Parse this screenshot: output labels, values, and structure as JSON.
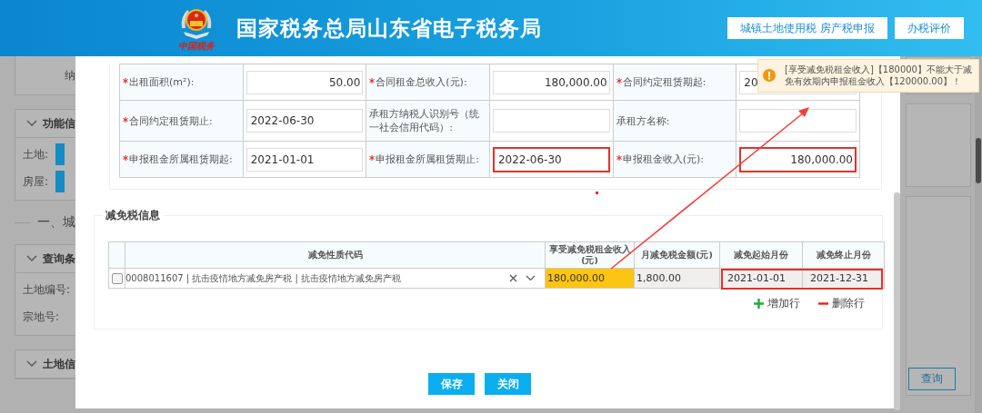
{
  "header": {
    "logo_caption": "中国税务",
    "title": "国家税务总局山东省电子税务局",
    "nav_buttons": [
      "城镇土地使用税 房产税申报",
      "办税评价"
    ]
  },
  "background_page": {
    "left": {
      "top_label": "纳",
      "panels": [
        {
          "title": "功能信",
          "fields": [
            "土地:",
            "房屋:"
          ]
        },
        {
          "section": "一、城"
        },
        {
          "title": "查询条",
          "fields": [
            "土地编号:",
            "宗地号:"
          ]
        },
        {
          "title": "土地信"
        }
      ]
    },
    "query_button": "查询"
  },
  "form": {
    "rows": [
      [
        {
          "kind": "label",
          "text": "出租面积(m²):",
          "required": true
        },
        {
          "kind": "amount",
          "value": "50.00",
          "highlighted": false
        },
        {
          "kind": "label",
          "text": "合同租金总收入(元):",
          "required": true
        },
        {
          "kind": "amount",
          "value": "180,000.00",
          "highlighted": false
        },
        {
          "kind": "label",
          "text": "合同约定租赁期起:",
          "required": true
        },
        {
          "kind": "input",
          "value": "20",
          "highlighted": false
        }
      ],
      [
        {
          "kind": "label",
          "text": "合同约定租赁期止:",
          "required": true
        },
        {
          "kind": "input",
          "value": "2022-06-30",
          "highlighted": false
        },
        {
          "kind": "label",
          "text": "承租方纳税人识别号（统一社会信用代码）:",
          "required": false
        },
        {
          "kind": "input",
          "highlighted": false
        },
        {
          "kind": "label",
          "text": "承租方名称:",
          "required": false
        },
        {
          "kind": "input",
          "highlighted": false
        }
      ],
      [
        {
          "kind": "label",
          "text": "申报租金所属租赁期起:",
          "required": true
        },
        {
          "kind": "input",
          "value": "2021-01-01",
          "highlighted": false
        },
        {
          "kind": "label",
          "text": "申报租金所属租赁期止:",
          "required": true
        },
        {
          "kind": "input",
          "value": "2022-06-30",
          "highlighted": true
        },
        {
          "kind": "label",
          "text": "申报租金收入(元):",
          "required": true
        },
        {
          "kind": "amount",
          "value": "180,000.00",
          "highlighted": true
        }
      ]
    ]
  },
  "reduction": {
    "title": "减免税信息",
    "columns": [
      "减免性质代码",
      "享受减免税租金收入(元)",
      "月减免税金额(元)",
      "减免起始月份",
      "减免终止月份"
    ],
    "rows": [
      {
        "checked": false,
        "code": "0008011607 | 抗击疫情地方减免房产税 | 抗击疫情地方减免房产税",
        "income": "180,000.00",
        "income_error": true,
        "monthly": "1,800.00",
        "start": "2021-01-01",
        "end": "2021-12-31",
        "dates_highlighted": true
      }
    ],
    "actions": [
      {
        "kind": "add",
        "label": "增加行"
      },
      {
        "kind": "remove",
        "label": "删除行"
      }
    ]
  },
  "buttons": [
    "保存",
    "关闭"
  ],
  "tooltip": {
    "kind": "warning",
    "text": "[享受减免税租金收入]【180000】不能大于减免有效期内申报租金收入【120000.00】！"
  }
}
